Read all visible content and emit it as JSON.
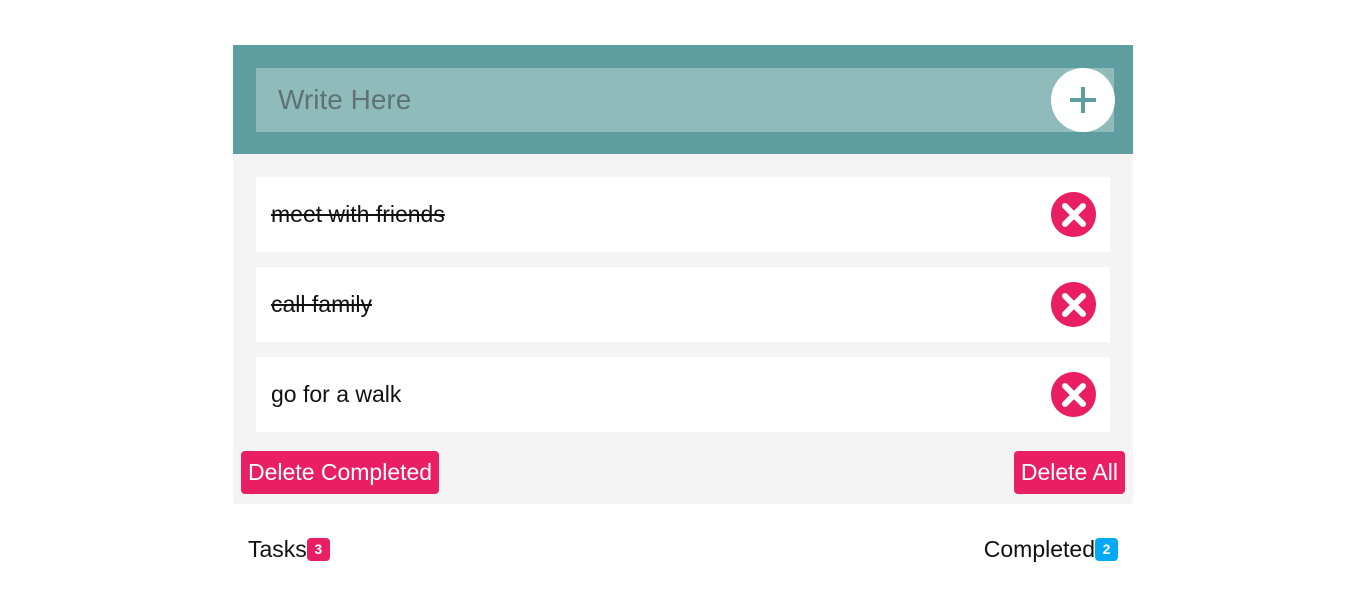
{
  "input": {
    "placeholder": "Write Here",
    "value": ""
  },
  "add_icon": "plus-icon",
  "tasks": [
    {
      "text": "meet with friends",
      "completed": true
    },
    {
      "text": "call family",
      "completed": true
    },
    {
      "text": "go for a walk",
      "completed": false
    }
  ],
  "remove_icon": "close-icon",
  "actions": {
    "delete_completed_label": "Delete Completed",
    "delete_all_label": "Delete All"
  },
  "footer": {
    "tasks_label": "Tasks",
    "tasks_count": "3",
    "completed_label": "Completed",
    "completed_count": "2"
  },
  "colors": {
    "header": "#5f9ea0",
    "input_bg": "#90bbbb",
    "accent": "#e91e63",
    "completed_badge": "#03a9f4"
  }
}
